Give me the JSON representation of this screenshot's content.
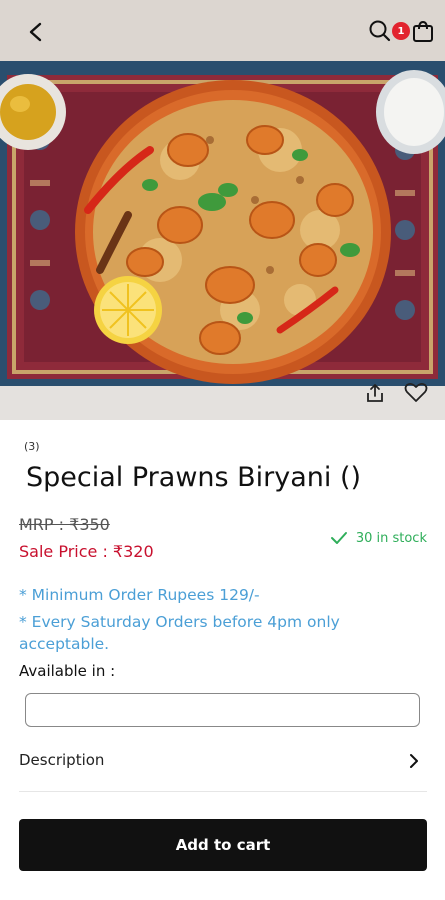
{
  "header": {
    "cart_count": "1"
  },
  "product": {
    "rating_count": "(3)",
    "title": "Special Prawns Biryani ()",
    "mrp": "MRP : ₹350",
    "sale_price": "Sale Price : ₹320",
    "stock_text": "30 in stock",
    "notes": [
      "* Minimum Order Rupees 129/-",
      "* Every Saturday Orders before 4pm only acceptable."
    ],
    "available_label": "Available in :",
    "available_value": "",
    "description_label": "Description",
    "add_to_cart_label": "Add to cart"
  },
  "colors": {
    "sale_price": "#c8102e",
    "stock": "#2fae5a",
    "note": "#4b9fd6",
    "cart_badge": "#e2232e",
    "primary_button": "#111111"
  },
  "icons": {
    "back": "back-arrow-icon",
    "search": "search-icon",
    "cart": "shopping-bag-icon",
    "share": "share-icon",
    "wishlist": "heart-icon",
    "stock_check": "check-icon",
    "description_chevron": "chevron-right-icon"
  }
}
